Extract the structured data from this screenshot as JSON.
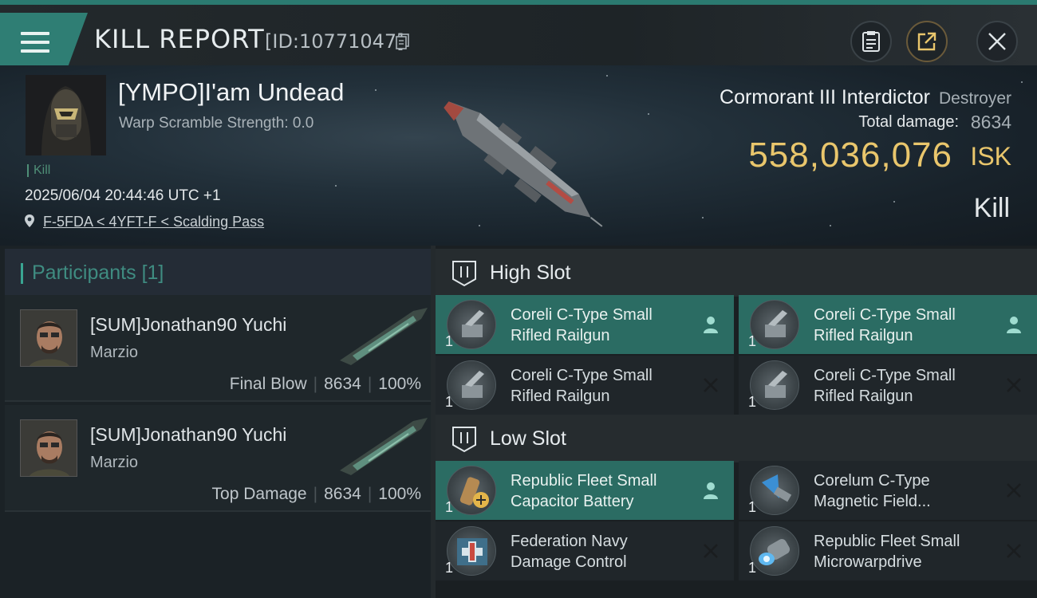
{
  "header": {
    "title": "KILL REPORT",
    "report_id": "[ID:10771047]"
  },
  "victim": {
    "name": "[YMPO]I'am Undead",
    "warp_scramble": "Warp Scramble Strength: 0.0",
    "kill_tag": "Kill",
    "time": "2025/06/04 20:44:46 UTC +1",
    "location": "F-5FDA < 4YFT-F < Scalding Pass"
  },
  "ship": {
    "name": "Cormorant III Interdictor",
    "class": "Destroyer",
    "damage_label": "Total damage:",
    "damage_value": "8634",
    "isk_value": "558,036,076",
    "isk_unit": "ISK",
    "result": "Kill"
  },
  "participants": {
    "label": "Participants",
    "count": "[1]",
    "rows": [
      {
        "name": "[SUM]Jonathan90 Yuchi",
        "corp": "Marzio",
        "role": "Final Blow",
        "damage": "8634",
        "percent": "100%"
      },
      {
        "name": "[SUM]Jonathan90 Yuchi",
        "corp": "Marzio",
        "role": "Top Damage",
        "damage": "8634",
        "percent": "100%"
      }
    ]
  },
  "slots": {
    "high": {
      "label": "High Slot",
      "modules": [
        {
          "qty": "1",
          "line1": "Coreli C-Type Small",
          "line2": "Rifled Railgun",
          "status": "dropped"
        },
        {
          "qty": "1",
          "line1": "Coreli C-Type Small",
          "line2": "Rifled Railgun",
          "status": "dropped"
        },
        {
          "qty": "1",
          "line1": "Coreli C-Type Small",
          "line2": "Rifled Railgun",
          "status": "destroyed"
        },
        {
          "qty": "1",
          "line1": "Coreli C-Type Small",
          "line2": "Rifled Railgun",
          "status": "destroyed"
        }
      ]
    },
    "low": {
      "label": "Low Slot",
      "modules": [
        {
          "qty": "1",
          "line1": "Republic Fleet Small",
          "line2": "Capacitor Battery",
          "status": "dropped"
        },
        {
          "qty": "1",
          "line1": "Corelum C-Type",
          "line2": "Magnetic Field...",
          "status": "destroyed"
        },
        {
          "qty": "1",
          "line1": "Federation Navy",
          "line2": "Damage Control",
          "status": "destroyed"
        },
        {
          "qty": "1",
          "line1": "Republic Fleet Small",
          "line2": "Microwarpdrive",
          "status": "destroyed"
        }
      ]
    }
  },
  "colors": {
    "accent": "#2f7e74",
    "isk": "#e9c66c",
    "active_module": "#2b6c63"
  }
}
